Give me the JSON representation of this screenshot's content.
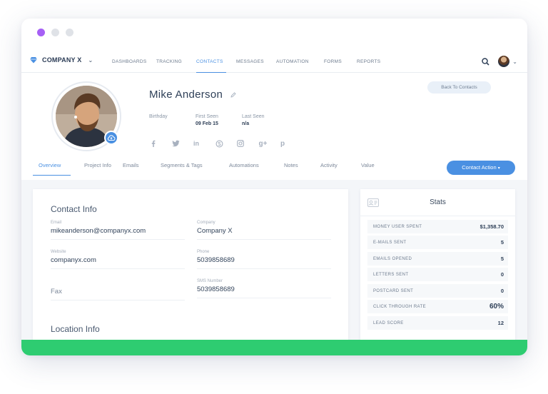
{
  "brand": {
    "name": "COMPANY X"
  },
  "nav": {
    "links": [
      "DASHBOARDS",
      "TRACKING",
      "CONTACTS",
      "MESSAGES",
      "AUTOMATION",
      "FORMS",
      "REPORTS"
    ],
    "active": "CONTACTS"
  },
  "profile": {
    "name": "Mike Anderson",
    "birthday_label": "Birthday",
    "first_seen_label": "First Seen",
    "first_seen_value": "09 Feb 15",
    "last_seen_label": "Last Seen",
    "last_seen_value": "n/a",
    "socials": [
      "facebook-icon",
      "twitter-icon",
      "linkedin-icon",
      "skype-icon",
      "instagram-icon",
      "google-plus-icon",
      "pinterest-icon"
    ]
  },
  "back_button": "Back To Contacts",
  "tabs": [
    "Overview",
    "Project Info",
    "Emails",
    "Segments & Tags",
    "Automations",
    "Notes",
    "Activity",
    "Value"
  ],
  "active_tab": "Overview",
  "contact_action": "Contact Action",
  "contact_info": {
    "title": "Contact Info",
    "email_label": "Email",
    "email": "mikeanderson@companyx.com",
    "company_label": "Company",
    "company": "Company X",
    "website_label": "Website",
    "website": "companyx.com",
    "phone_label": "Phone",
    "phone": "5039858689",
    "sms_label": "SMS Number",
    "sms": "5039858689",
    "fax_placeholder": "Fax"
  },
  "location_info": {
    "title": "Location Info"
  },
  "stats": {
    "title": "Stats",
    "rows": [
      {
        "label": "MONEY USER SPENT",
        "value": "$1,358.70"
      },
      {
        "label": "E-MAILS SENT",
        "value": "5"
      },
      {
        "label": "EMAILS OPENED",
        "value": "5"
      },
      {
        "label": "LETTERS SENT",
        "value": "0"
      },
      {
        "label": "POSTCARD SENT",
        "value": "0"
      },
      {
        "label": "CLICK THROUGH RATE",
        "value": "60%"
      },
      {
        "label": "LEAD SCORE",
        "value": "12"
      }
    ]
  },
  "colors": {
    "accent": "#4a90e2",
    "footer": "#2ecc71",
    "dot_active": "#a660f5"
  }
}
